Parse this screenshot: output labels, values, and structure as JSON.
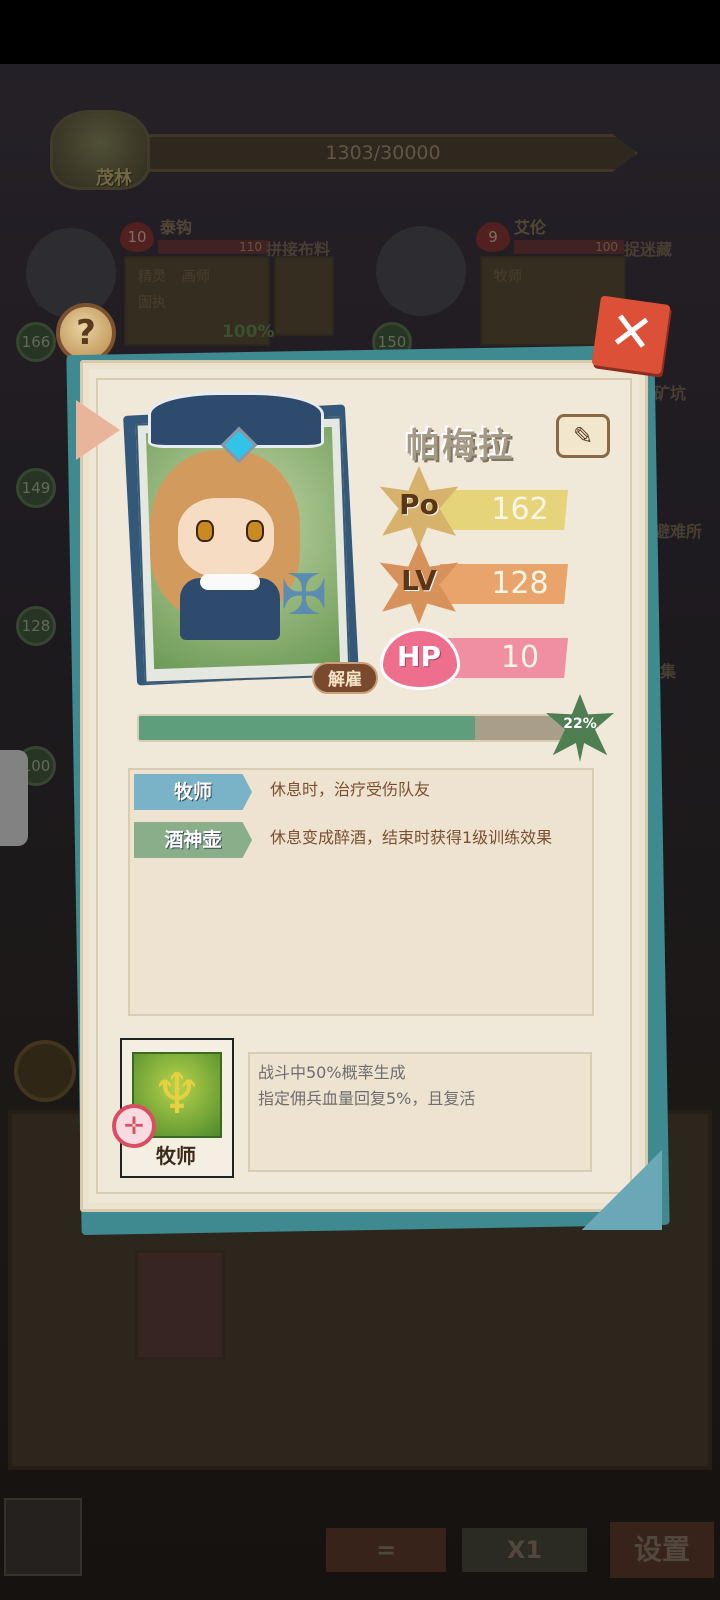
{
  "region": {
    "name": "茂林",
    "progress": "1303/30000"
  },
  "background_heroes": [
    {
      "name": "泰钩",
      "hearts": "10",
      "hp": "110",
      "item": "拼接布料",
      "jobs": [
        "精灵",
        "画师"
      ],
      "trait": "固执",
      "pct": "100%",
      "level": "166"
    },
    {
      "name": "艾伦",
      "hearts": "9",
      "hp": "100",
      "item": "捉迷藏",
      "jobs": [
        "牧师"
      ],
      "level": "150"
    }
  ],
  "background_levels": [
    "149",
    "128",
    "100"
  ],
  "background_side_items": [
    "矿坑",
    "避难所",
    "集"
  ],
  "hero": {
    "name": "帕梅拉",
    "unlock_label": "解雇",
    "stats": {
      "po_label": "Po",
      "po_value": "162",
      "lv_label": "LV",
      "lv_value": "128",
      "hp_label": "HP",
      "hp_value": "10"
    },
    "exp_percent_text": "22%",
    "exp_fraction": 0.77
  },
  "traits": [
    {
      "tag": "牧师",
      "description": "休息时，治疗受伤队友"
    },
    {
      "tag": "酒神壶",
      "description": "休息变成醉酒，结束时获得1级训练效果"
    }
  ],
  "skill": {
    "label": "牧师",
    "description_lines": [
      "战斗中50%概率生成",
      "指定佣兵血量回复5%，且复活"
    ]
  },
  "bottom_bar": {
    "eq_label": "=",
    "speed_label": "X1",
    "settings_label": "设置"
  },
  "icons": {
    "help": "question-icon",
    "close": "close-icon",
    "edit": "pencil-icon",
    "target": "target-icon"
  },
  "colors": {
    "dialog_bg": "#efe7d6",
    "dialog_border": "#3e8a90",
    "close": "#dd5038",
    "po": "#e6d47a",
    "lv": "#e8a46a",
    "hp": "#f08ea2",
    "exp": "#5e9e7c"
  }
}
